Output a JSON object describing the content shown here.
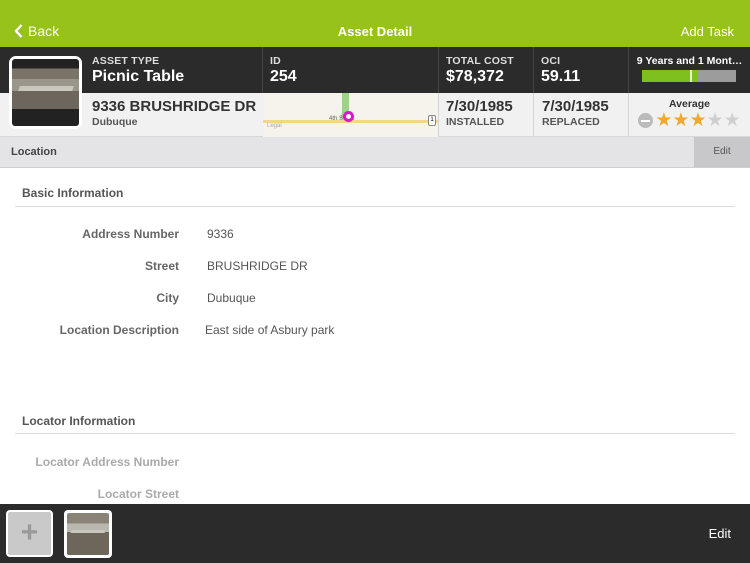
{
  "navbar": {
    "back_label": "Back",
    "title": "Asset Detail",
    "add_task_label": "Add Task",
    "bg_color": "#97c21a"
  },
  "asset": {
    "type_label": "ASSET TYPE",
    "type_value": "Picnic Table",
    "id_label": "ID",
    "id_value": "254",
    "total_cost_label": "TOTAL COST",
    "total_cost_value": "$78,372",
    "oci_label": "OCI",
    "oci_value": "59.11",
    "address": "9336 BRUSHRIDGE DR",
    "city": "Dubuque",
    "installed_date": "7/30/1985",
    "installed_label": "INSTALLED",
    "replaced_date": "7/30/1985",
    "replaced_label": "REPLACED",
    "life_text": "9 Years and 1 Mont…",
    "life_progress_pct": 60,
    "life_marker_pct": 51,
    "condition_label": "Average",
    "condition_rating": 3,
    "condition_max": 5
  },
  "map": {
    "street_label": "4th St SE",
    "legal_label": "Legal",
    "route_shield": "1"
  },
  "section": {
    "title": "Location",
    "edit_label": "Edit"
  },
  "basic_info": {
    "title": "Basic Information",
    "rows": [
      {
        "label": "Address Number",
        "value": "9336"
      },
      {
        "label": "Street",
        "value": "BRUSHRIDGE DR"
      },
      {
        "label": "City",
        "value": "Dubuque"
      },
      {
        "label": "Location Description",
        "value": "East side of Asbury park"
      }
    ]
  },
  "locator_info": {
    "title": "Locator Information",
    "rows": [
      {
        "label": "Locator Address Number",
        "value": ""
      },
      {
        "label": "Locator Street",
        "value": ""
      }
    ]
  },
  "footer": {
    "add_label": "+",
    "edit_label": "Edit"
  }
}
